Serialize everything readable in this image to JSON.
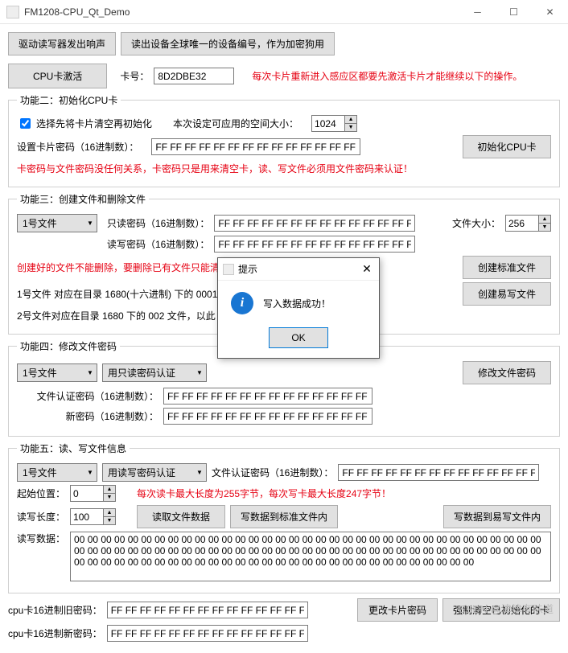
{
  "window": {
    "title": "FM1208-CPU_Qt_Demo"
  },
  "top": {
    "btn_beep": "驱动读写器发出响声",
    "btn_devno": "读出设备全球唯一的设备编号，作为加密狗用"
  },
  "activate": {
    "btn": "CPU卡激活",
    "cardno_lbl": "卡号：",
    "cardno": "8D2DBE32",
    "warn": "每次卡片重新进入感应区都要先激活卡片才能继续以下的操作。"
  },
  "g2": {
    "legend": "功能二：初始化CPU卡",
    "cb": "选择先将卡片清空再初始化",
    "space_lbl": "本次设定可应用的空间大小：",
    "space": "1024",
    "pwd_lbl": "设置卡片密码（16进制数）：",
    "pwd": "FF FF FF FF FF FF FF FF FF FF FF FF FF FF FF FF",
    "warn": "卡密码与文件密码没任何关系，卡密码只是用来清空卡，读、写文件必须用文件密码来认证！",
    "btn": "初始化CPU卡"
  },
  "g3": {
    "legend": "功能三：创建文件和删除文件",
    "file_combo": "1号文件",
    "ro_lbl": "只读密码（16进制数）：",
    "ro": "FF FF FF FF FF FF FF FF FF FF FF FF FF FF FF FF",
    "rw_lbl": "读写密码（16进制数）：",
    "rw": "FF FF FF FF FF FF FF FF FF FF FF FF FF FF FF FF",
    "size_lbl": "文件大小：",
    "size": "256",
    "warn": "创建好的文件不能删除，要删除已有文件只能清",
    "note1": "1号文件 对应在目录 1680(十六进制) 下的 0001",
    "note2": "2号文件对应在目录 1680 下的 002 文件，以此",
    "btn_std": "创建标准文件",
    "btn_easy": "创建易写文件"
  },
  "g4": {
    "legend": "功能四：修改文件密码",
    "file_combo": "1号文件",
    "auth_combo": "用只读密码认证",
    "btn": "修改文件密码",
    "auth_lbl": "文件认证密码（16进制数）：",
    "auth": "FF FF FF FF FF FF FF FF FF FF FF FF FF FF FF FF",
    "new_lbl": "新密码（16进制数）：",
    "new": "FF FF FF FF FF FF FF FF FF FF FF FF FF FF FF FF"
  },
  "g5": {
    "legend": "功能五：读、写文件信息",
    "file_combo": "1号文件",
    "auth_combo": "用读写密码认证",
    "auth_lbl": "文件认证密码（16进制数）：",
    "auth": "FF FF FF FF FF FF FF FF FF FF FF FF FF FF FF FF",
    "start_lbl": "起始位置：",
    "start": "0",
    "len_lbl": "读写长度：",
    "len": "100",
    "warn": "每次读卡最大长度为255字节，每次写卡最大长度247字节！",
    "btn_read": "读取文件数据",
    "btn_write_std": "写数据到标准文件内",
    "btn_write_easy": "写数据到易写文件内",
    "data_lbl": "读写数据：",
    "data": "00 00 00 00 00 00 00 00 00 00 00 00 00 00 00 00 00 00 00 00 00 00 00 00 00 00 00 00 00 00 00 00 00 00 00 00 00 00 00 00 00 00 00 00 00 00 00 00 00 00 00 00 00 00 00 00 00 00 00 00 00 00 00 00 00 00 00 00 00 00 00 00 00 00 00 00 00 00 00 00 00 00 00 00 00 00 00 00 00 00 00 00 00 00 00 00 00 00 00 00"
  },
  "bottom": {
    "old_lbl": "cpu卡16进制旧密码：",
    "old": "FF FF FF FF FF FF FF FF FF FF FF FF FF FF FF FF",
    "new_lbl": "cpu卡16进制新密码：",
    "new": "FF FF FF FF FF FF FF FF FF FF FF FF FF FF FF FF",
    "btn_change": "更改卡片密码",
    "btn_clear": "强制清空已初始化的卡"
  },
  "dialog": {
    "title": "提示",
    "msg": "写入数据成功！",
    "ok": "OK"
  },
  "watermark": "CSDN @津津有味道"
}
